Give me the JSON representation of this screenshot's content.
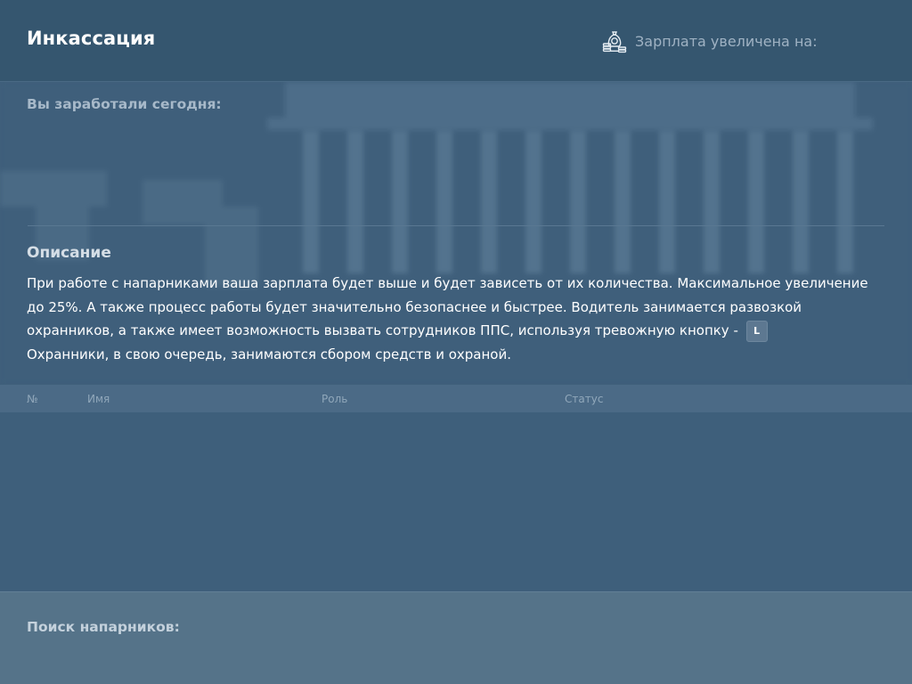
{
  "header": {
    "title": "Инкассация",
    "salary_label": "Зарплата увеличена на:",
    "salary_icon": "money-bag-icon"
  },
  "earnings": {
    "label": "Вы заработали сегодня:"
  },
  "description": {
    "title": "Описание",
    "line1": "При работе с напарниками ваша зарплата будет выше и будет зависеть от их количества. Максимальное увеличение до 25%. А также процесс работы будет значительно безопаснее и быстрее. Водитель занимается развозкой охранников, а также имеет возможность вызвать сотрудников ППС, используя тревожную кнопку - ",
    "key": "L",
    "line2": "Охранники, в свою очередь, занимаются сбором средств и охраной."
  },
  "table": {
    "columns": [
      "№",
      "Имя",
      "Роль",
      "Статус"
    ],
    "rows": []
  },
  "search": {
    "label": "Поиск напарников:"
  }
}
